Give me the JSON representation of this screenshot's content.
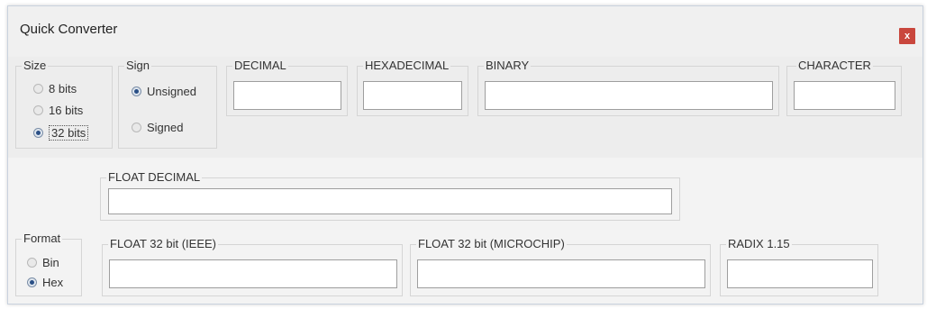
{
  "window": {
    "title": "Quick Converter",
    "close_label": "x"
  },
  "size": {
    "label": "Size",
    "options": [
      "8 bits",
      "16 bits",
      "32 bits"
    ],
    "selected": "32 bits"
  },
  "sign": {
    "label": "Sign",
    "options": [
      "Unsigned",
      "Signed"
    ],
    "selected": "Unsigned"
  },
  "fields": {
    "decimal": {
      "label": "DECIMAL",
      "value": ""
    },
    "hexadecimal": {
      "label": "HEXADECIMAL",
      "value": ""
    },
    "binary": {
      "label": "BINARY",
      "value": ""
    },
    "character": {
      "label": "CHARACTER",
      "value": ""
    },
    "float_decimal": {
      "label": "FLOAT DECIMAL",
      "value": ""
    },
    "float32_ieee": {
      "label": "FLOAT 32 bit (IEEE)",
      "value": ""
    },
    "float32_microchip": {
      "label": "FLOAT 32 bit (MICROCHIP)",
      "value": ""
    },
    "radix": {
      "label": "RADIX 1.15",
      "value": ""
    }
  },
  "format": {
    "label": "Format",
    "options": [
      "Bin",
      "Hex"
    ],
    "selected": "Hex"
  },
  "colors": {
    "close": "#c9473d",
    "radio_dot": "#2a4f86",
    "background": "#f0f0f0"
  }
}
